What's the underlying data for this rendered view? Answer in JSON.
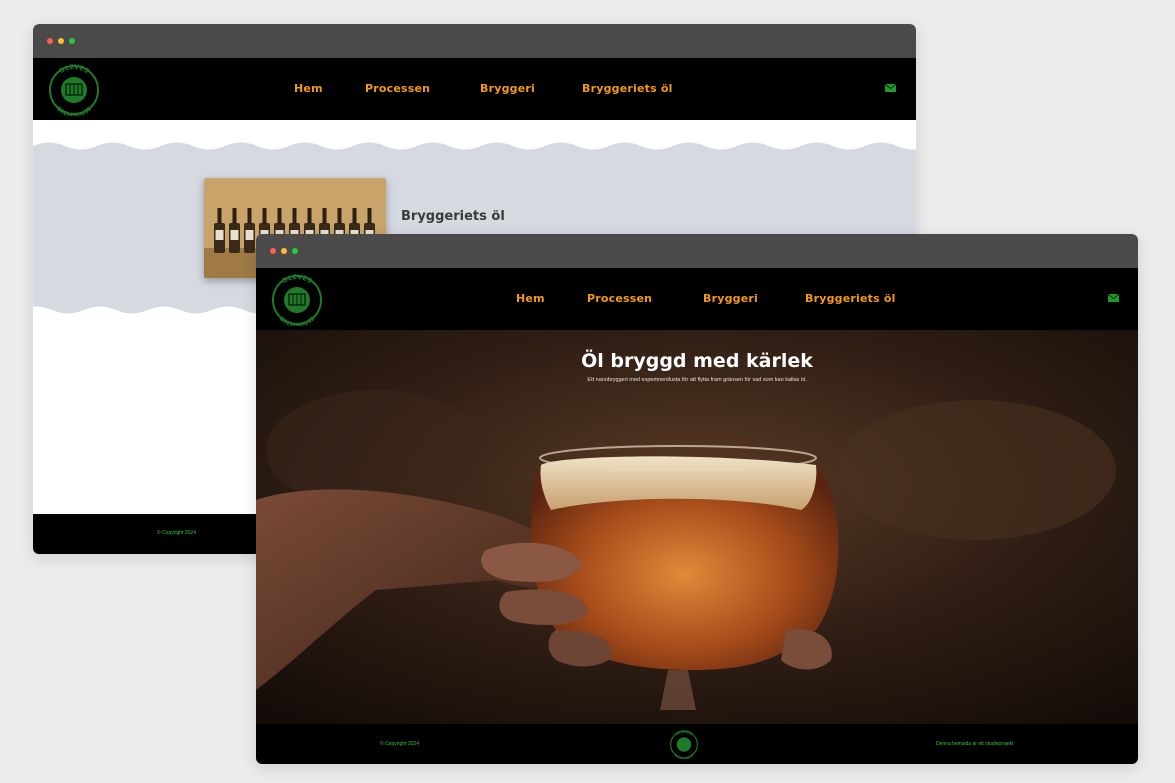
{
  "brand": {
    "logo_top": "OLEVES",
    "logo_bottom": "BREWHOUSE",
    "accent": "#f29a16",
    "green": "#1f7a2a"
  },
  "nav": {
    "items": [
      "Hem",
      "Processen",
      "Bryggeri",
      "Bryggeriets öl"
    ]
  },
  "icons": {
    "mail": "envelope-icon"
  },
  "back_window": {
    "section_title": "Bryggeriets öl",
    "band_color": "#d5d9e0",
    "footer_copyright": "© Copyright 2024"
  },
  "front_window": {
    "hero_title": "Öl bryggd med kärlek",
    "hero_subtitle": "Ett nanobryggeri med experimentlusta för att flytta fram gränsen för vad som kan kallas öl.",
    "footer_copyright": "© Copyright 2024",
    "footer_right": "Denna hemsida är ett studieprojekt"
  }
}
